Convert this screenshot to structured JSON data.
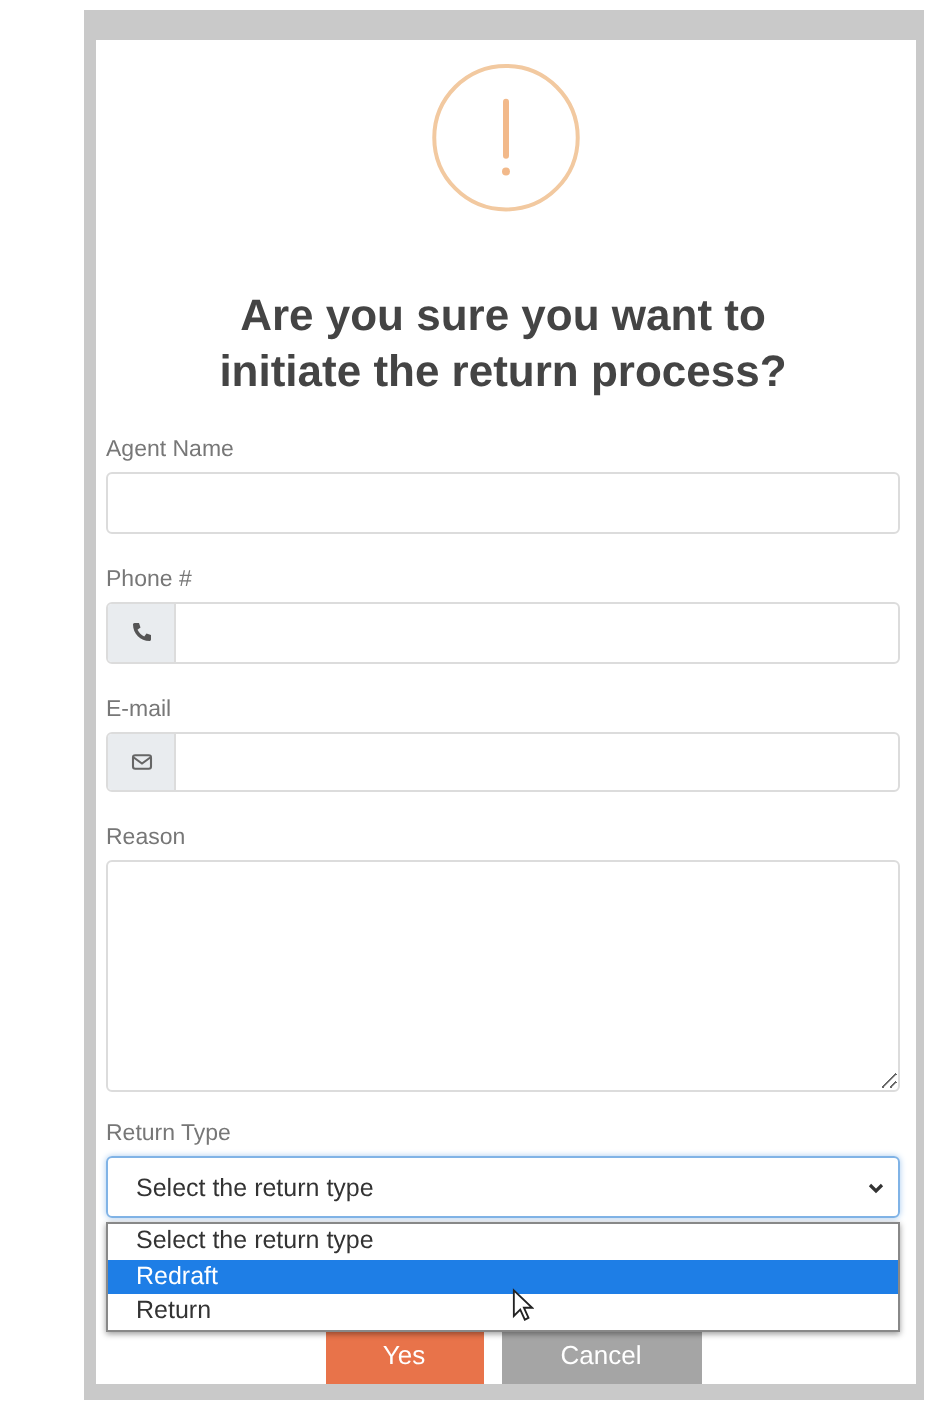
{
  "dialog": {
    "title": "Are you sure you want to initiate the return process?",
    "fields": [
      {
        "kind": "text",
        "label": "Agent Name"
      },
      {
        "kind": "phone",
        "label": "Phone #"
      },
      {
        "kind": "email",
        "label": "E-mail"
      },
      {
        "kind": "textarea",
        "label": "Reason"
      },
      {
        "kind": "select",
        "label": "Return Type",
        "value": "Select the return type",
        "expanded": true,
        "options": [
          {
            "label": "Select the return type",
            "highlighted": false
          },
          {
            "label": "Redraft",
            "highlighted": true
          },
          {
            "label": "Return",
            "highlighted": false
          }
        ]
      }
    ],
    "buttons": [
      {
        "kind": "primary",
        "label": "Yes"
      },
      {
        "kind": "secondary",
        "label": "Cancel"
      }
    ]
  }
}
